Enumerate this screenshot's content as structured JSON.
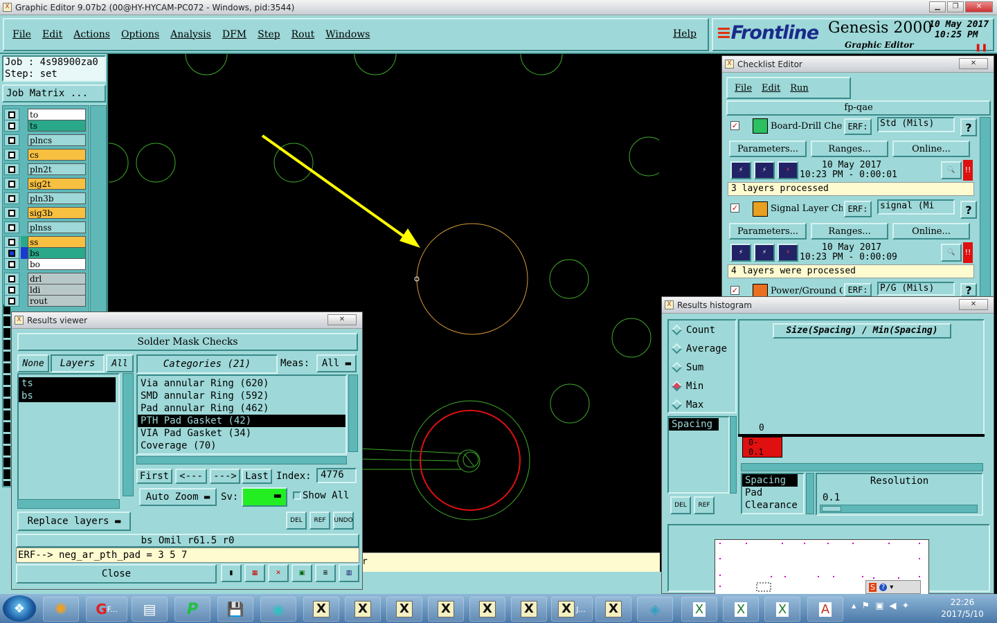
{
  "window": {
    "title": "Graphic Editor 9.07b2 (00@HY-HYCAM-PC072 - Windows, pid:3544)"
  },
  "menu": {
    "items": [
      "File",
      "Edit",
      "Actions",
      "Options",
      "Analysis",
      "DFM",
      "Step",
      "Rout",
      "Windows"
    ],
    "help": "Help"
  },
  "brand": {
    "logo": "Frontline",
    "product": "Genesis 2000",
    "module": "Graphic Editor",
    "date": "10 May 2017",
    "time": "10:25 PM"
  },
  "job": {
    "job_label": "Job : 4s98900za0",
    "step_label": "Step: set",
    "matrix_button": "Job Matrix ..."
  },
  "layers": [
    {
      "name": "to",
      "color": "#ffffff"
    },
    {
      "name": "ts",
      "color": "#2aa88a"
    },
    {
      "name": "plncs",
      "color": "#9ed8d8"
    },
    {
      "name": "cs",
      "color": "#f7c040"
    },
    {
      "name": "pln2t",
      "color": "#9ed8d8"
    },
    {
      "name": "sig2t",
      "color": "#f7c040"
    },
    {
      "name": "pln3b",
      "color": "#9ed8d8"
    },
    {
      "name": "sig3b",
      "color": "#f7c040"
    },
    {
      "name": "plnss",
      "color": "#9ed8d8"
    },
    {
      "name": "ss",
      "color": "#f7c040"
    },
    {
      "name": "bs",
      "color": "#2aa88a"
    },
    {
      "name": "bo",
      "color": "#ffffff"
    },
    {
      "name": "drl",
      "color": "#b8c8c8"
    },
    {
      "name": "ldi",
      "color": "#b8c8c8"
    },
    {
      "name": "rout",
      "color": "#b8c8c8"
    }
  ],
  "results_viewer": {
    "title": "Results viewer",
    "header": "Solder Mask Checks",
    "none_label": "None",
    "layers_label": "Layers",
    "all_label": "All",
    "categories_label": "Categories (21)",
    "meas_label": "Meas:",
    "meas_value": "All",
    "layer_list": [
      "ts",
      "bs"
    ],
    "categories": [
      "Via annular Ring (620)",
      "SMD annular Ring (592)",
      "Pad annular Ring (462)",
      "PTH Pad Gasket (42)",
      "VIA Pad Gasket (34)",
      "Coverage (70)"
    ],
    "selected_category": "PTH Pad Gasket (42)",
    "nav": {
      "first": "First",
      "prev": "<---",
      "next": "--->",
      "last": "Last",
      "index_label": "Index:",
      "index_value": "4776"
    },
    "auto_zoom": "Auto Zoom",
    "sv_label": "Sv:",
    "show_all": "Show All",
    "replace_layers": "Replace layers",
    "del_label": "DEL",
    "ref_label": "REF",
    "undo_label": "UNDO",
    "status": "bs Omil   r61.5   r0",
    "erf": "ERF--> neg_ar_pth_pad = 3 5 7",
    "close": "Close"
  },
  "checklist": {
    "title": "Checklist Editor",
    "menu": [
      "File",
      "Edit",
      "Run"
    ],
    "name": "fp-qae",
    "items": [
      {
        "name": "Board-Drill Che",
        "erf": "ERF:",
        "erf_value": "Std (Mils)",
        "params": "Parameters...",
        "ranges": "Ranges...",
        "online": "Online...",
        "date": "10 May 2017",
        "time": "10:23 PM - 0:00:01",
        "status": "3 layers processed"
      },
      {
        "name": "Signal Layer Ch",
        "erf": "ERF:",
        "erf_value": "signal (Mi",
        "params": "Parameters...",
        "ranges": "Ranges...",
        "online": "Online...",
        "date": "10 May 2017",
        "time": "10:23 PM - 0:00:09",
        "status": "4 layers were processed"
      },
      {
        "name": "Power/Ground C",
        "erf": "ERF:",
        "erf_value": "P/G (Mils)"
      }
    ]
  },
  "histogram": {
    "title": "Results histogram",
    "modes": [
      "Count",
      "Average",
      "Sum",
      "Min",
      "Max"
    ],
    "selected_mode": "Min",
    "chart_title": "Size(Spacing) / Min(Spacing)",
    "zero_label": "0",
    "bin_label": "0-\n0.1",
    "list_item": "Spacing",
    "types": [
      "Spacing",
      "Pad",
      "Clearance"
    ],
    "resolution_label": "Resolution",
    "resolution_value": "0.1",
    "del_label": "DEL",
    "ref_label": "REF"
  },
  "bottom_bar": {
    "text": "r"
  },
  "taskbar": {
    "clock_time": "22:26",
    "clock_date": "2017/5/10",
    "item_f": "F...",
    "item_j": "J..."
  },
  "colors": {
    "teal": "#9ed8d8",
    "accent_yellow": "#ffff00",
    "feature_green": "#3fae2a",
    "selected_orange": "#d59b3a",
    "red": "#e01010"
  }
}
